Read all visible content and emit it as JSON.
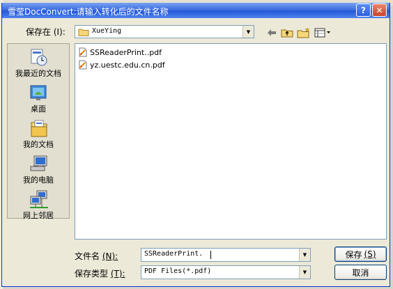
{
  "window": {
    "title": "雪莹DocConvert:请输入转化后的文件名称",
    "help_label": "?",
    "close_label": "✕"
  },
  "save_in": {
    "label": "保存在",
    "hotkey": "(I):",
    "folder": "XueYing"
  },
  "places": [
    {
      "label": "我最近的文档",
      "icon": "recent-documents-icon"
    },
    {
      "label": "桌面",
      "icon": "desktop-icon"
    },
    {
      "label": "我的文档",
      "icon": "my-documents-icon"
    },
    {
      "label": "我的电脑",
      "icon": "my-computer-icon"
    },
    {
      "label": "网上邻居",
      "icon": "network-places-icon"
    }
  ],
  "files": [
    {
      "name": "SSReaderPrint..pdf",
      "icon": "pdf-file-icon"
    },
    {
      "name": "yz.uestc.edu.cn.pdf",
      "icon": "pdf-file-icon"
    }
  ],
  "filename": {
    "label": "文件名",
    "hotkey": "(N):",
    "value": "SSReaderPrint."
  },
  "filetype": {
    "label": "保存类型",
    "hotkey": "(T):",
    "value": "PDF Files(*.pdf)"
  },
  "buttons": {
    "save": "保存",
    "save_hotkey": "(S)",
    "cancel": "取消"
  }
}
